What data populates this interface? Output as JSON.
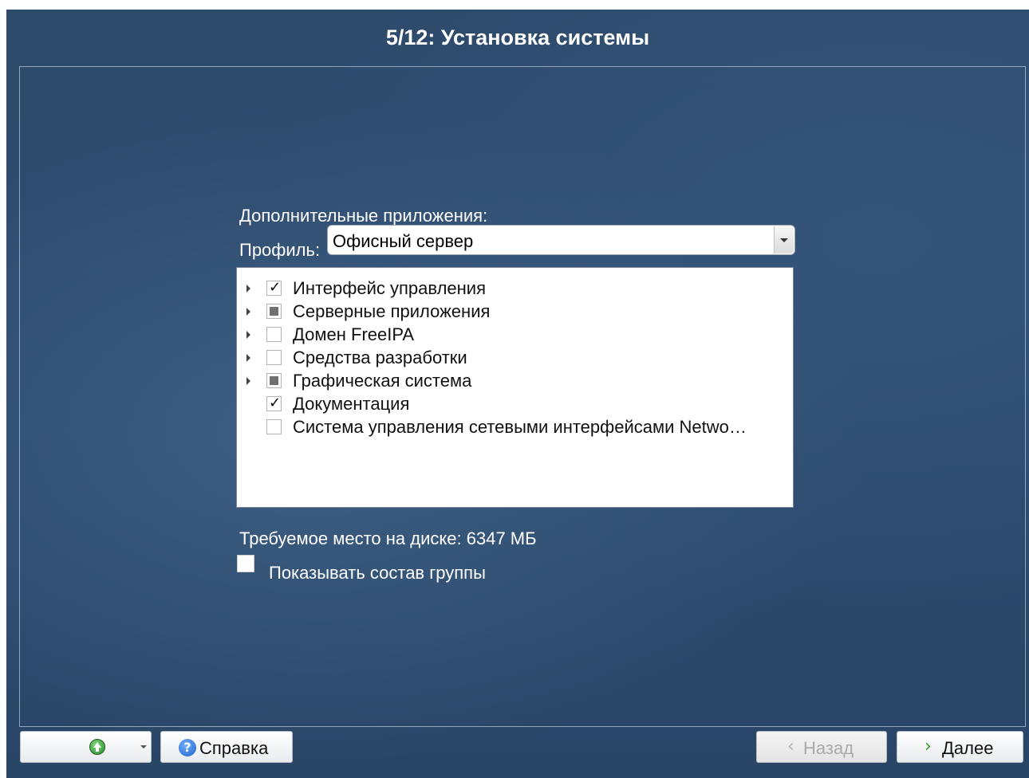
{
  "window": {
    "title": "5/12: Установка системы"
  },
  "section": {
    "heading": "Дополнительные приложения:"
  },
  "profile": {
    "label": "Профиль:",
    "selected": "Офисный сервер"
  },
  "groups": [
    {
      "label": "Интерфейс управления",
      "state": "checked",
      "expandable": true
    },
    {
      "label": "Серверные приложения",
      "state": "partial",
      "expandable": true
    },
    {
      "label": "Домен FreeIPA",
      "state": "unchecked",
      "expandable": true
    },
    {
      "label": "Средства разработки",
      "state": "unchecked",
      "expandable": true
    },
    {
      "label": "Графическая система",
      "state": "partial",
      "expandable": true
    },
    {
      "label": "Документация",
      "state": "checked",
      "expandable": false
    },
    {
      "label": "Система управления сетевыми интерфейсами Netwo…",
      "state": "unchecked",
      "expandable": false
    }
  ],
  "disk": {
    "text": "Требуемое место на диске: 6347 МБ"
  },
  "show_group": {
    "label": "Показывать состав группы",
    "checked": false
  },
  "buttons": {
    "help": "Справка",
    "back": "Назад",
    "next": "Далее",
    "back_chevron": "‹",
    "next_chevron": "›"
  },
  "icons": {
    "up": "up-arrow-icon",
    "help": "help-icon",
    "help_glyph": "?"
  }
}
